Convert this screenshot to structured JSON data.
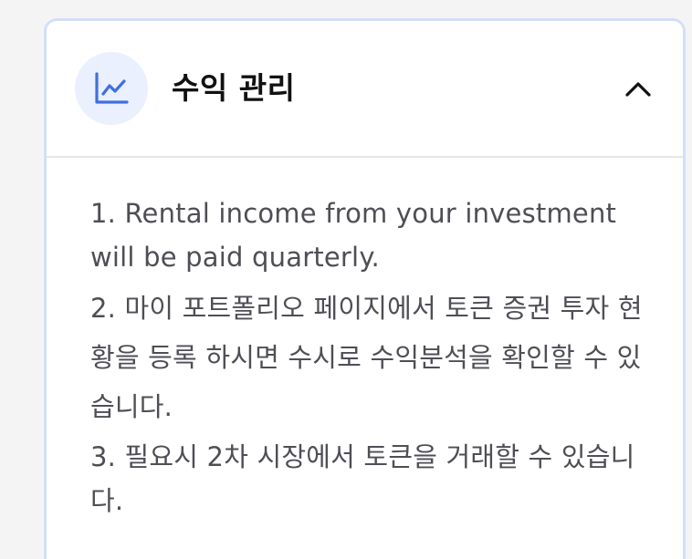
{
  "panel": {
    "title": "수익 관리",
    "icon": "line-chart-icon",
    "toggle_icon": "chevron-up-icon",
    "accent_color": "#3f6fe0",
    "expanded": true
  },
  "notices": [
    "1. Rental income from your investment will be paid quarterly.",
    "2. 마이 포트폴리오 페이지에서 토큰 증권 투자 현황을 등록 하시면 수시로 수익분석을 확인할 수 있습니다.",
    "3. 필요시 2차 시장에서 토큰을 거래할 수 있습니다."
  ]
}
